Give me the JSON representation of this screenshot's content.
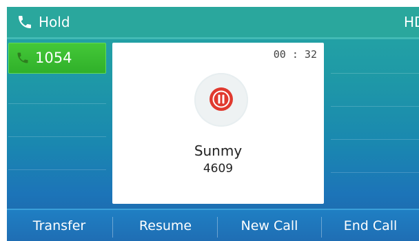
{
  "status_bar": {
    "title": "Hold",
    "badge": "HD",
    "icon": "phone-icon"
  },
  "lines": {
    "active": {
      "label": "1054",
      "icon": "phone-icon",
      "color": "#3bbf33"
    }
  },
  "call": {
    "duration": "00 : 32",
    "name": "Sunmy",
    "number": "4609",
    "state_icon": "pause-icon",
    "state_color": "#e03a2f"
  },
  "softkeys": [
    {
      "label": "Transfer"
    },
    {
      "label": "Resume"
    },
    {
      "label": "New Call"
    },
    {
      "label": "End Call"
    }
  ]
}
